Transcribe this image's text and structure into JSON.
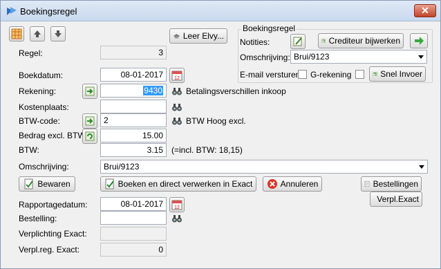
{
  "window": {
    "title": "Boekingsregel",
    "close_label": "✕"
  },
  "toolbar": {
    "leer_label": "Leer Elvy..."
  },
  "group": {
    "title": "Boekingsregel",
    "notities_label": "Notities:",
    "crediteur_label": "Crediteur bijwerken",
    "omschrijving_label": "Omschrijving:",
    "omschrijving_value": "Brui/9123",
    "email_label": "E-mail versturen",
    "grekening_label": "G-rekening",
    "snel_label": "Snel Invoer"
  },
  "form": {
    "regel_label": "Regel:",
    "regel_value": "3",
    "boekdatum_label": "Boekdatum:",
    "boekdatum_value": "08-01-2017",
    "rekening_label": "Rekening:",
    "rekening_value": "9430",
    "rekening_desc": "Betalingsverschillen inkoop",
    "kostenplaats_label": "Kostenplaats:",
    "kostenplaats_value": "",
    "btwcode_label": "BTW-code:",
    "btwcode_value": "2",
    "btwcode_desc": "BTW Hoog excl.",
    "bedrag_label": "Bedrag excl. BTW:",
    "bedrag_value": "15.00",
    "btw_label": "BTW:",
    "btw_value": "3.15",
    "btw_note": "(=incl. BTW: 18,15)",
    "omschrijving_label": "Omschrijving:",
    "omschrijving_value": "Brui/9123",
    "rapportagedatum_label": "Rapportagedatum:",
    "rapportagedatum_value": "08-01-2017",
    "bestelling_label": "Bestelling:",
    "bestelling_value": "",
    "verplichting_label": "Verplichting Exact:",
    "verplichting_value": "",
    "verplreg_label": "Verpl.reg. Exact:",
    "verplreg_value": "0"
  },
  "actions": {
    "bewaren": "Bewaren",
    "boeken": "Boeken en direct verwerken in Exact",
    "annuleren": "Annuleren",
    "bestellingen": "Bestellingen",
    "verpl_exact": "Verpl.Exact"
  },
  "calendar_day": "12",
  "icons": [
    "grid-icon",
    "arrow-up-icon",
    "arrow-down-icon",
    "hat-icon",
    "notes-icon",
    "refresh-icon",
    "arrow-right-icon",
    "calendar-icon",
    "binoculars-icon",
    "goto-icon",
    "save-icon",
    "error-icon",
    "document-icon"
  ],
  "colors": {
    "selection": "#3399ff",
    "title_bg": "#c9d9ee",
    "close_bg": "#c2432b"
  }
}
